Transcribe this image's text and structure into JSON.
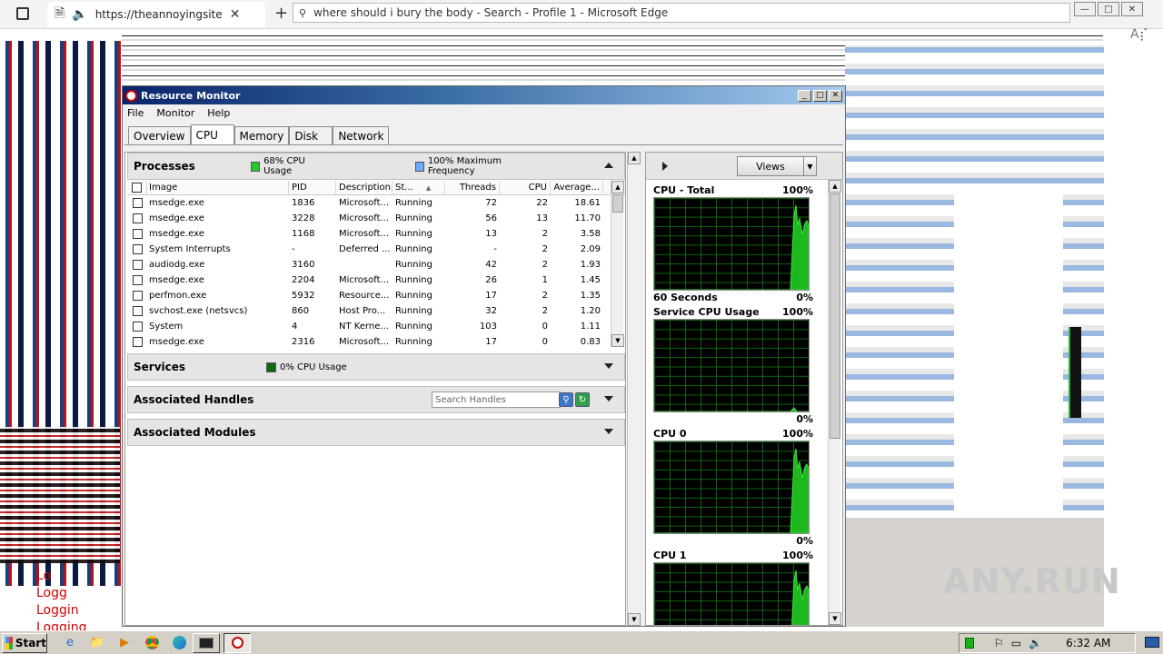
{
  "browser": {
    "tab_url": "https://theannoyingsite.co",
    "window_title": "where should i bury the body - Search - Profile 1 - Microsoft Edge"
  },
  "background": {
    "logging_lines": [
      "Lo",
      "Logg",
      "Loggin",
      "Logging"
    ],
    "watermark": "ANY.RUN"
  },
  "resmon": {
    "title": "Resource Monitor",
    "menu": [
      "File",
      "Monitor",
      "Help"
    ],
    "tabs": [
      "Overview",
      "CPU",
      "Memory",
      "Disk",
      "Network"
    ],
    "active_tab": "CPU",
    "processes": {
      "title": "Processes",
      "legend1": "68% CPU Usage",
      "legend1_color": "#22cc22",
      "legend2": "100% Maximum Frequency",
      "legend2_color": "#6fa8ff",
      "columns": [
        "Image",
        "PID",
        "Description",
        "St...",
        "Threads",
        "CPU",
        "Average..."
      ],
      "rows": [
        {
          "image": "msedge.exe",
          "pid": "1836",
          "desc": "Microsoft...",
          "status": "Running",
          "threads": "72",
          "cpu": "22",
          "avg": "18.61"
        },
        {
          "image": "msedge.exe",
          "pid": "3228",
          "desc": "Microsoft...",
          "status": "Running",
          "threads": "56",
          "cpu": "13",
          "avg": "11.70"
        },
        {
          "image": "msedge.exe",
          "pid": "1168",
          "desc": "Microsoft...",
          "status": "Running",
          "threads": "13",
          "cpu": "2",
          "avg": "3.58"
        },
        {
          "image": "System Interrupts",
          "pid": "-",
          "desc": "Deferred ...",
          "status": "Running",
          "threads": "-",
          "cpu": "2",
          "avg": "2.09"
        },
        {
          "image": "audiodg.exe",
          "pid": "3160",
          "desc": "",
          "status": "Running",
          "threads": "42",
          "cpu": "2",
          "avg": "1.93"
        },
        {
          "image": "msedge.exe",
          "pid": "2204",
          "desc": "Microsoft...",
          "status": "Running",
          "threads": "26",
          "cpu": "1",
          "avg": "1.45"
        },
        {
          "image": "perfmon.exe",
          "pid": "5932",
          "desc": "Resource...",
          "status": "Running",
          "threads": "17",
          "cpu": "2",
          "avg": "1.35"
        },
        {
          "image": "svchost.exe (netsvcs)",
          "pid": "860",
          "desc": "Host Pro...",
          "status": "Running",
          "threads": "32",
          "cpu": "2",
          "avg": "1.20"
        },
        {
          "image": "System",
          "pid": "4",
          "desc": "NT Kerne...",
          "status": "Running",
          "threads": "103",
          "cpu": "0",
          "avg": "1.11"
        },
        {
          "image": "msedge.exe",
          "pid": "2316",
          "desc": "Microsoft...",
          "status": "Running",
          "threads": "17",
          "cpu": "0",
          "avg": "0.83"
        }
      ]
    },
    "services": {
      "title": "Services",
      "legend": "0% CPU Usage",
      "legend_color": "#116611"
    },
    "handles": {
      "title": "Associated Handles",
      "search_placeholder": "Search Handles"
    },
    "modules": {
      "title": "Associated Modules"
    },
    "views_label": "Views",
    "graphs": [
      {
        "title": "CPU - Total",
        "max": "100%",
        "foot_left": "60 Seconds",
        "foot_right": "0%"
      },
      {
        "title": "Service CPU Usage",
        "max": "100%",
        "foot_left": "",
        "foot_right": "0%"
      },
      {
        "title": "CPU 0",
        "max": "100%",
        "foot_left": "",
        "foot_right": "0%"
      },
      {
        "title": "CPU 1",
        "max": "100%",
        "foot_left": "",
        "foot_right": ""
      }
    ]
  },
  "taskbar": {
    "start_label": "Start",
    "clock": "6:32 AM"
  }
}
